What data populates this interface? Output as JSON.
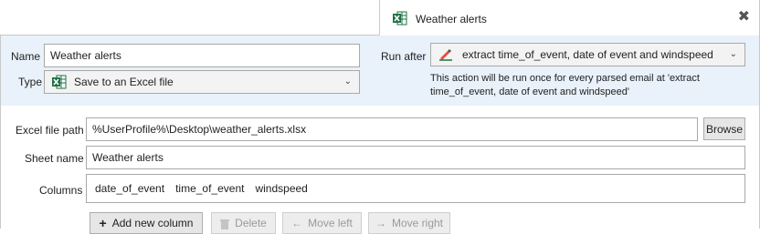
{
  "tab": {
    "title": "Weather alerts",
    "close_label": "✖"
  },
  "action": {
    "name_label": "Name",
    "name_value": "Weather alerts",
    "type_label": "Type",
    "type_value": "Save to an Excel file",
    "run_after_label": "Run after",
    "run_after_value": "extract time_of_event, date of event and windspeed",
    "info_line1": "This action will be run once for every parsed email at 'extract",
    "info_line2": "time_of_event, date of event and windspeed'"
  },
  "excel": {
    "file_path_label": "Excel file path",
    "file_path_value": "%UserProfile%\\Desktop\\weather_alerts.xlsx",
    "browse_label": "Browse",
    "sheet_name_label": "Sheet name",
    "sheet_name_value": "Weather alerts",
    "columns_label": "Columns",
    "columns": [
      "date_of_event",
      "time_of_event",
      "windspeed"
    ]
  },
  "buttons": {
    "add_column": "Add new column",
    "delete": "Delete",
    "move_left": "Move left",
    "move_right": "Move right"
  },
  "colors": {
    "panel_bg": "#e9f1fa",
    "excel_green": "#1e7145"
  }
}
